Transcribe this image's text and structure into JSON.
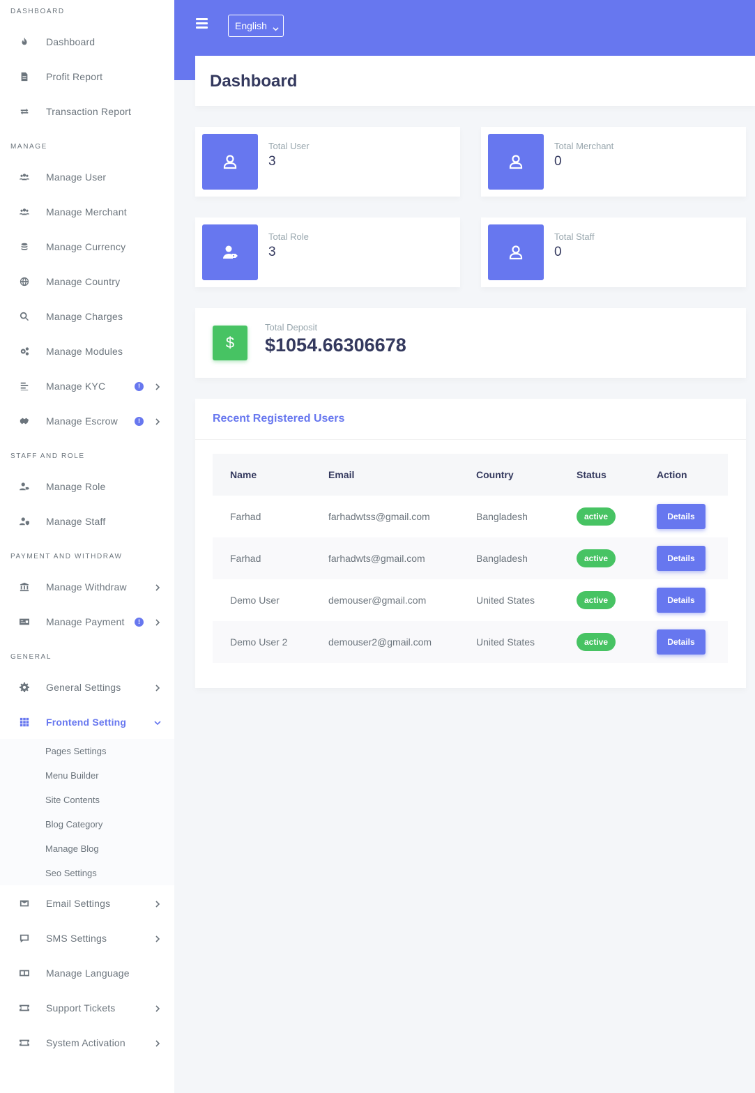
{
  "sidebar": {
    "sections": {
      "dashboard": "DASHBOARD",
      "manage": "MANAGE",
      "staff_role": "STAFF AND ROLE",
      "payment_withdraw": "PAYMENT AND WITHDRAW",
      "general": "GENERAL"
    },
    "items": {
      "dashboard": "Dashboard",
      "profit_report": "Profit Report",
      "transaction_report": "Transaction Report",
      "manage_user": "Manage User",
      "manage_merchant": "Manage Merchant",
      "manage_currency": "Manage Currency",
      "manage_country": "Manage Country",
      "manage_charges": "Manage Charges",
      "manage_modules": "Manage Modules",
      "manage_kyc": "Manage KYC",
      "manage_escrow": "Manage Escrow",
      "manage_role": "Manage Role",
      "manage_staff": "Manage Staff",
      "manage_withdraw": "Manage Withdraw",
      "manage_payment": "Manage Payment",
      "general_settings": "General Settings",
      "frontend_setting": "Frontend Setting",
      "email_settings": "Email Settings",
      "sms_settings": "SMS Settings",
      "manage_language": "Manage Language",
      "support_tickets": "Support Tickets",
      "system_activation": "System Activation"
    },
    "badge": "!",
    "frontend_sub": {
      "pages": "Pages Settings",
      "menu": "Menu Builder",
      "site": "Site Contents",
      "blog_cat": "Blog Category",
      "blog": "Manage Blog",
      "seo": "Seo Settings"
    }
  },
  "topbar": {
    "language": "English"
  },
  "header": {
    "title": "Dashboard"
  },
  "stats": {
    "total_user": {
      "label": "Total User",
      "value": "3"
    },
    "total_merchant": {
      "label": "Total Merchant",
      "value": "0"
    },
    "total_role": {
      "label": "Total Role",
      "value": "3"
    },
    "total_staff": {
      "label": "Total Staff",
      "value": "0"
    },
    "total_deposit": {
      "label": "Total Deposit",
      "value": "$1054.66306678",
      "icon": "$"
    }
  },
  "users": {
    "title": "Recent Registered Users",
    "columns": {
      "name": "Name",
      "email": "Email",
      "country": "Country",
      "status": "Status",
      "action": "Action"
    },
    "rows": [
      {
        "name": "Farhad",
        "email": "farhadwtss@gmail.com",
        "country": "Bangladesh",
        "status": "active",
        "action": "Details"
      },
      {
        "name": "Farhad",
        "email": "farhadwts@gmail.com",
        "country": "Bangladesh",
        "status": "active",
        "action": "Details"
      },
      {
        "name": "Demo User",
        "email": "demouser@gmail.com",
        "country": "United States",
        "status": "active",
        "action": "Details"
      },
      {
        "name": "Demo User 2",
        "email": "demouser2@gmail.com",
        "country": "United States",
        "status": "active",
        "action": "Details"
      }
    ]
  },
  "colors": {
    "primary": "#6777ef",
    "success": "#47c363",
    "background": "#f4f6f9"
  }
}
